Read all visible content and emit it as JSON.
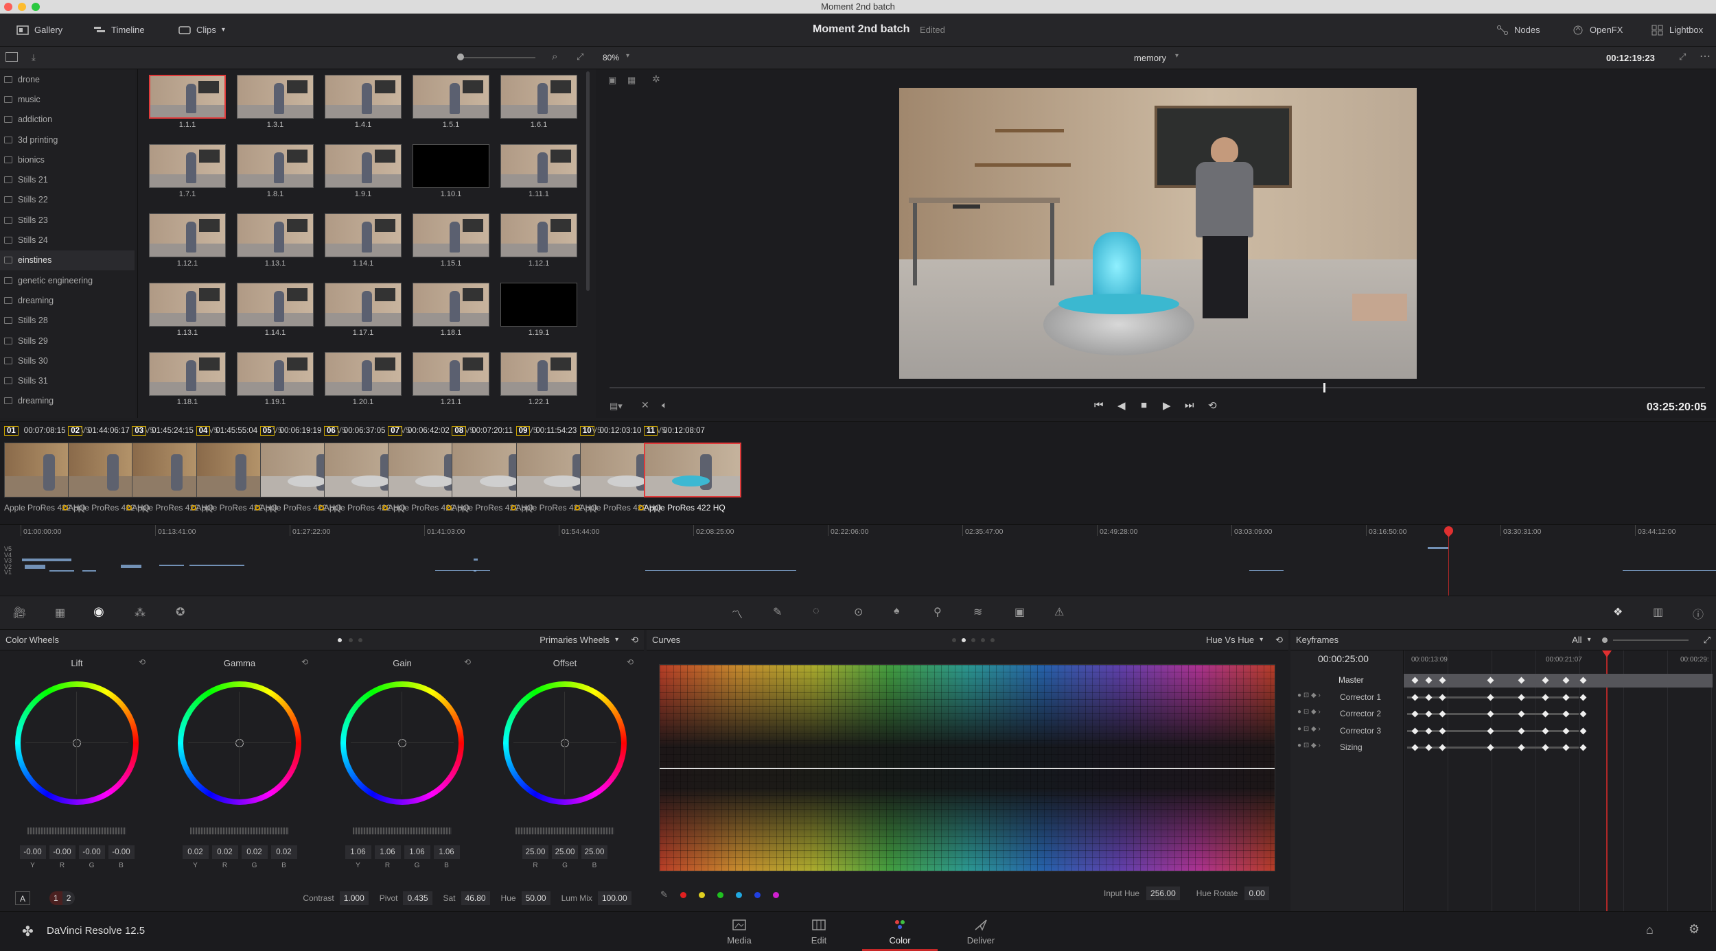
{
  "window": {
    "title": "Moment 2nd batch"
  },
  "topbar": {
    "gallery": "Gallery",
    "timeline": "Timeline",
    "clips": "Clips",
    "project": "Moment 2nd batch",
    "status": "Edited",
    "nodes": "Nodes",
    "openfx": "OpenFX",
    "lightbox": "Lightbox"
  },
  "subbar": {
    "zoom": "80%",
    "clip_name": "memory",
    "timecode": "00:12:19:23"
  },
  "albums": [
    "drone",
    "music",
    "addiction",
    "3d printing",
    "bionics",
    "Stills 21",
    "Stills 22",
    "Stills 23",
    "Stills 24",
    "einstines",
    "genetic engineering",
    "dreaming",
    "Stills 28",
    "Stills 29",
    "Stills 30",
    "Stills 31",
    "dreaming"
  ],
  "album_selected": "einstines",
  "stills": [
    "1.1.1",
    "1.3.1",
    "1.4.1",
    "1.5.1",
    "1.6.1",
    "1.7.1",
    "1.8.1",
    "1.9.1",
    "1.10.1",
    "1.11.1",
    "1.12.1",
    "1.13.1",
    "1.14.1",
    "1.15.1",
    "1.12.1",
    "1.13.1",
    "1.14.1",
    "1.17.1",
    "1.18.1",
    "1.19.1",
    "1.18.1",
    "1.19.1",
    "1.20.1",
    "1.21.1",
    "1.22.1"
  ],
  "viewer": {
    "timecode": "03:25:20:05"
  },
  "clips": [
    {
      "num": "01",
      "tc": "00:07:08:15",
      "track": "V5",
      "codec": "Apple ProRes 422 HQ"
    },
    {
      "num": "02",
      "tc": "01:44:06:17",
      "track": "V5",
      "codec": "Apple ProRes 422 HQ"
    },
    {
      "num": "03",
      "tc": "01:45:24:15",
      "track": "V5",
      "codec": "Apple ProRes 422 HQ"
    },
    {
      "num": "04",
      "tc": "01:45:55:04",
      "track": "V5",
      "codec": "Apple ProRes 422 HQ"
    },
    {
      "num": "05",
      "tc": "00:06:19:19",
      "track": "V5",
      "codec": "Apple ProRes 422 HQ"
    },
    {
      "num": "06",
      "tc": "00:06:37:05",
      "track": "V5",
      "codec": "Apple ProRes 422 HQ"
    },
    {
      "num": "07",
      "tc": "00:06:42:02",
      "track": "V5",
      "codec": "Apple ProRes 422 HQ"
    },
    {
      "num": "08",
      "tc": "00:07:20:11",
      "track": "V5",
      "codec": "Apple ProRes 422 HQ"
    },
    {
      "num": "09",
      "tc": "00:11:54:23",
      "track": "V5",
      "codec": "Apple ProRes 422 HQ"
    },
    {
      "num": "10",
      "tc": "00:12:03:10",
      "track": "V5",
      "codec": "Apple ProRes 422 HQ"
    },
    {
      "num": "11",
      "tc": "00:12:08:07",
      "track": "",
      "codec": "Apple ProRes 422 HQ"
    }
  ],
  "ruler": [
    "01:00:00:00",
    "01:13:41:00",
    "01:27:22:00",
    "01:41:03:00",
    "01:54:44:00",
    "02:08:25:00",
    "02:22:06:00",
    "02:35:47:00",
    "02:49:28:00",
    "03:03:09:00",
    "03:16:50:00",
    "03:30:31:00",
    "03:44:12:00"
  ],
  "tracks": [
    "V5",
    "V4",
    "V3",
    "V2",
    "V1"
  ],
  "color_wheels": {
    "title": "Color Wheels",
    "mode": "Primaries Wheels",
    "wheels": [
      {
        "name": "Lift",
        "values": [
          "-0.00",
          "-0.00",
          "-0.00",
          "-0.00"
        ],
        "letters": [
          "Y",
          "R",
          "G",
          "B"
        ]
      },
      {
        "name": "Gamma",
        "values": [
          "0.02",
          "0.02",
          "0.02",
          "0.02"
        ],
        "letters": [
          "Y",
          "R",
          "G",
          "B"
        ]
      },
      {
        "name": "Gain",
        "values": [
          "1.06",
          "1.06",
          "1.06",
          "1.06"
        ],
        "letters": [
          "Y",
          "R",
          "G",
          "B"
        ]
      },
      {
        "name": "Offset",
        "values": [
          "25.00",
          "25.00",
          "25.00"
        ],
        "letters": [
          "R",
          "G",
          "B"
        ]
      }
    ],
    "contrast_label": "Contrast",
    "contrast": "1.000",
    "pivot_label": "Pivot",
    "pivot": "0.435",
    "sat_label": "Sat",
    "sat": "46.80",
    "hue_label": "Hue",
    "hue": "50.00",
    "lummix_label": "Lum Mix",
    "lummix": "100.00",
    "a_label": "A",
    "page1": "1",
    "page2": "2"
  },
  "curves": {
    "title": "Curves",
    "mode": "Hue Vs Hue",
    "input_hue_label": "Input Hue",
    "input_hue": "256.00",
    "hue_rotate_label": "Hue Rotate",
    "hue_rotate": "0.00"
  },
  "keyframes": {
    "title": "Keyframes",
    "filter": "All",
    "timecode": "00:00:25:00",
    "ruler": [
      "00:00:13:09",
      "00:00:21:07",
      "00:00:29:"
    ],
    "rows": [
      "Master",
      "Corrector 1",
      "Corrector 2",
      "Corrector 3",
      "Sizing"
    ]
  },
  "bottom": {
    "app": "DaVinci Resolve 12.5",
    "tabs": [
      "Media",
      "Edit",
      "Color",
      "Deliver"
    ],
    "active": "Color"
  }
}
